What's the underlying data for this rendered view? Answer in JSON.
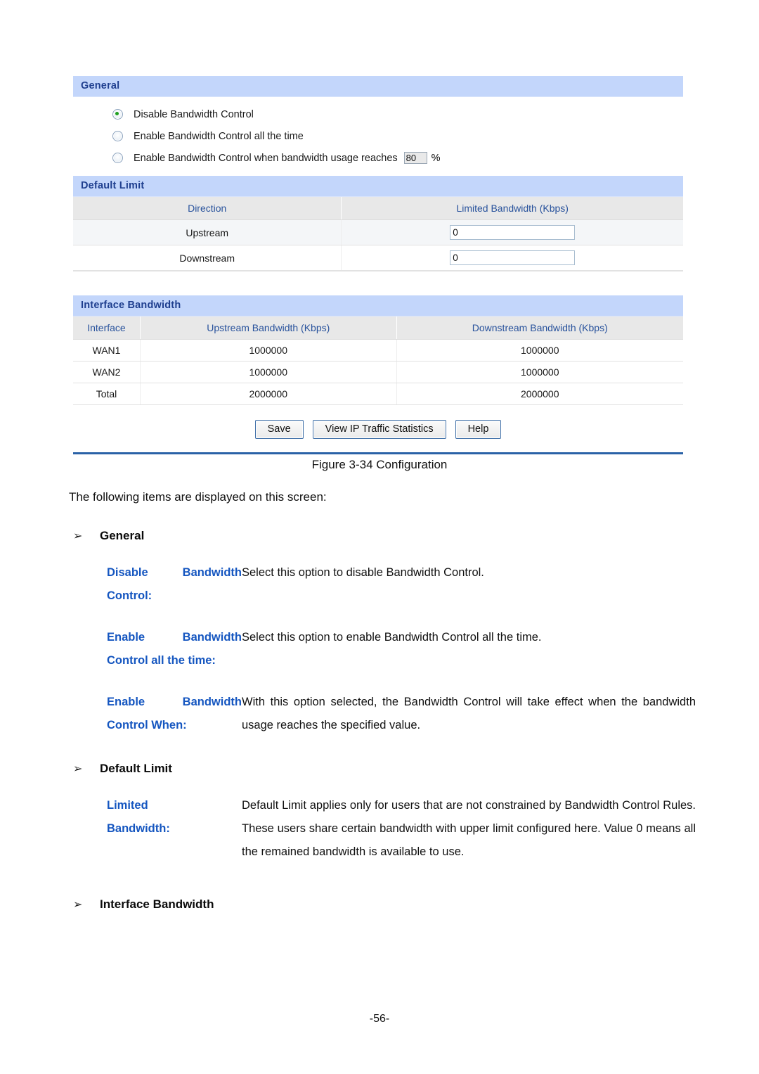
{
  "figure": {
    "caption": "Figure 3-34 Configuration",
    "general": {
      "header": "General",
      "options": [
        {
          "label": "Disable Bandwidth Control",
          "selected": true
        },
        {
          "label": "Enable Bandwidth Control all the time",
          "selected": false
        },
        {
          "label": "Enable Bandwidth Control when bandwidth usage reaches",
          "selected": false
        }
      ],
      "threshold_value": "80",
      "threshold_unit": "%"
    },
    "default_limit": {
      "header": "Default Limit",
      "columns": [
        "Direction",
        "Limited Bandwidth (Kbps)"
      ],
      "rows": [
        {
          "direction": "Upstream",
          "value": "0"
        },
        {
          "direction": "Downstream",
          "value": "0"
        }
      ]
    },
    "interface_bandwidth": {
      "header": "Interface Bandwidth",
      "columns": [
        "Interface",
        "Upstream Bandwidth (Kbps)",
        "Downstream Bandwidth (Kbps)"
      ],
      "rows": [
        {
          "interface": "WAN1",
          "upstream": "1000000",
          "downstream": "1000000"
        },
        {
          "interface": "WAN2",
          "upstream": "1000000",
          "downstream": "1000000"
        },
        {
          "interface": "Total",
          "upstream": "2000000",
          "downstream": "2000000"
        }
      ]
    },
    "buttons": {
      "save": "Save",
      "view_stats": "View IP Traffic Statistics",
      "help": "Help"
    }
  },
  "document": {
    "intro": "The following items are displayed on this screen:",
    "bullet": "➢",
    "sections": [
      {
        "heading": "General",
        "entries": [
          {
            "term_line1": "Disable Bandwidth",
            "term_line2": "Control:",
            "description": "Select this option to disable Bandwidth Control."
          },
          {
            "term_line1": "Enable Bandwidth",
            "term_line2": "Control all the time:",
            "description": "Select this option to enable Bandwidth Control all the time."
          },
          {
            "term_line1": "Enable Bandwidth",
            "term_line2": "Control When:",
            "description": "With this option selected, the Bandwidth Control will take effect when the bandwidth usage reaches the specified value."
          }
        ]
      },
      {
        "heading": "Default Limit",
        "entries": [
          {
            "term_line1": "Limited",
            "term_line2": "Bandwidth:",
            "description": "Default Limit applies only for users that are not constrained by Bandwidth Control Rules. These users share certain bandwidth with upper limit configured here. Value 0 means all the remained bandwidth is available to use."
          }
        ]
      },
      {
        "heading": "Interface Bandwidth",
        "entries": []
      }
    ],
    "page_number": "-56-"
  },
  "colors": {
    "panel_header_bg": "#c3d6fb",
    "panel_header_text": "#1f3f8f",
    "table_header_text": "#28529c",
    "term_text": "#1556c0",
    "rule": "#2a62a7",
    "radio_dot": "#1fa01f"
  }
}
